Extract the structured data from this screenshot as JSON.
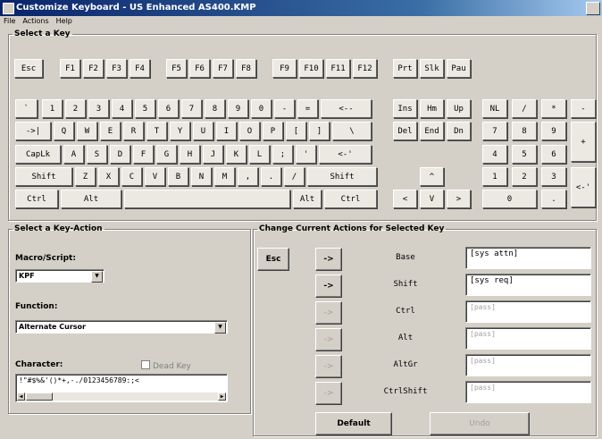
{
  "window": {
    "title": "Customize Keyboard - US Enhanced    AS400.KMP"
  },
  "menu": [
    "File",
    "Actions",
    "Help"
  ],
  "select_key": {
    "legend": "Select a Key",
    "row_fn": [
      "Esc",
      "F1",
      "F2",
      "F3",
      "F4",
      "F5",
      "F6",
      "F7",
      "F8",
      "F9",
      "F10",
      "F11",
      "F12",
      "Prt",
      "Slk",
      "Pau"
    ],
    "row_num": [
      "`",
      "1",
      "2",
      "3",
      "4",
      "5",
      "6",
      "7",
      "8",
      "9",
      "0",
      "-",
      "=",
      "<--",
      "Ins",
      "Hm",
      "Up",
      "NL",
      "/",
      "*",
      "-"
    ],
    "row_q": [
      "->|",
      "Q",
      "W",
      "E",
      "R",
      "T",
      "Y",
      "U",
      "I",
      "O",
      "P",
      "[",
      "]",
      "\\",
      "Del",
      "End",
      "Dn",
      "7",
      "8",
      "9",
      "+"
    ],
    "row_a": [
      "CapLk",
      "A",
      "S",
      "D",
      "F",
      "G",
      "H",
      "J",
      "K",
      "L",
      ";",
      "'",
      "<-'",
      "4",
      "5",
      "6"
    ],
    "row_z": [
      "Shift",
      "Z",
      "X",
      "C",
      "V",
      "B",
      "N",
      "M",
      ",",
      ".",
      "/",
      "Shift",
      "^",
      "1",
      "2",
      "3",
      "<-'"
    ],
    "row_ctrl": [
      "Ctrl",
      "Alt",
      "",
      "Alt",
      "Ctrl",
      "<",
      "V",
      ">",
      "0",
      "."
    ]
  },
  "key_action": {
    "legend": "Select a Key-Action",
    "macro_label": "Macro/Script:",
    "macro_value": "KPF",
    "function_label": "Function:",
    "function_value": "Alternate Cursor",
    "character_label": "Character:",
    "dead_key_label": "Dead Key",
    "character_list": "!\"#$%&'()*+,-./0123456789:;<"
  },
  "change_actions": {
    "legend": "Change Current Actions for Selected Key",
    "esc_button": "Esc",
    "assign_arrow": "->",
    "rows": [
      {
        "modifier": "Base",
        "value": "[sys attn]"
      },
      {
        "modifier": "Shift",
        "value": "[sys req]"
      },
      {
        "modifier": "Ctrl",
        "value": "[pass]"
      },
      {
        "modifier": "Alt",
        "value": "[pass]"
      },
      {
        "modifier": "AltGr",
        "value": "[pass]"
      },
      {
        "modifier": "CtrlShift",
        "value": "[pass]"
      }
    ],
    "default_button": "Default",
    "undo_button": "Undo"
  }
}
